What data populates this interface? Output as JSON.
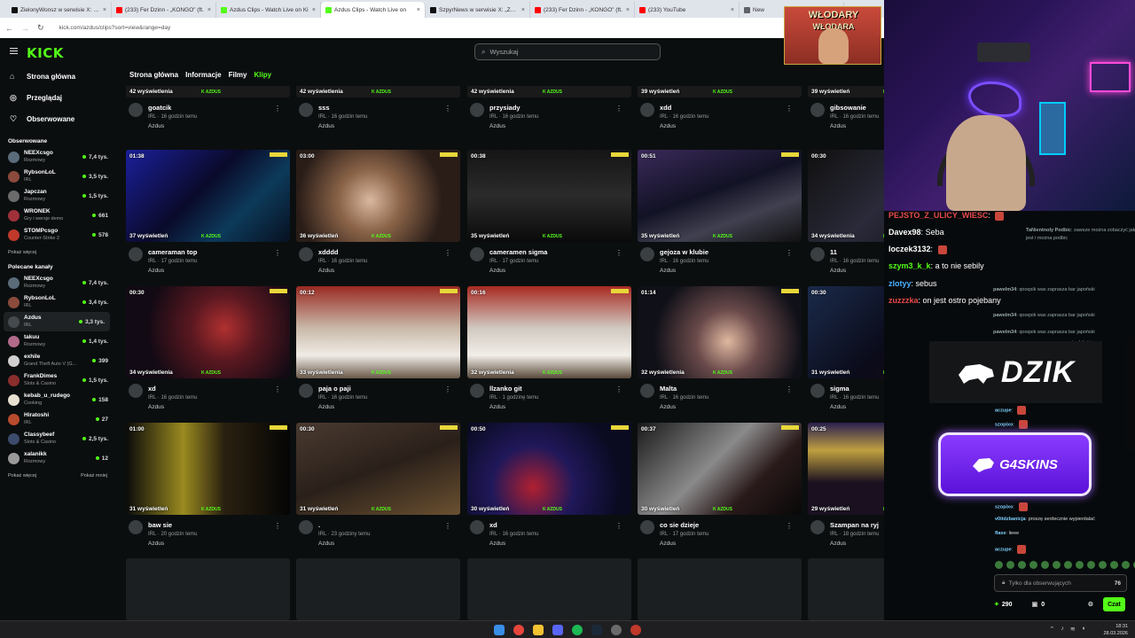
{
  "browser": {
    "tabs": [
      {
        "title": "ZielonyWonsz w serwisie X: „Je",
        "color": "#111111",
        "active": false
      },
      {
        "title": "(233) Fer Dzinn - „KONGO” (ft.",
        "color": "#ff0000",
        "active": false
      },
      {
        "title": "Azdus Clips - Watch Live on Ki",
        "color": "#53fc18",
        "active": false
      },
      {
        "title": "Azdus Clips - Watch Live on",
        "color": "#53fc18",
        "active": true
      },
      {
        "title": "SzpyrNews w serwisie X: „Zaup",
        "color": "#111111",
        "active": false
      },
      {
        "title": "(233) Fer Dzinn - „KONGO” (ft.",
        "color": "#ff0000",
        "active": false
      },
      {
        "title": "(233) YouTube",
        "color": "#ff0000",
        "active": false
      },
      {
        "title": "New",
        "color": "#5f6368",
        "active": false
      }
    ],
    "url": "kick.com/azdus/clips?sort=view&range=day"
  },
  "header": {
    "logo": "KICK",
    "search_placeholder": "Wyszukaj"
  },
  "sidebar": {
    "nav": [
      {
        "label": "Strona główna",
        "icon": "home-icon"
      },
      {
        "label": "Przeglądaj",
        "icon": "compass-icon"
      },
      {
        "label": "Obserwowane",
        "icon": "heart-icon"
      }
    ],
    "followed_title": "Obserwowane",
    "followed": [
      {
        "name": "NEEXcsgo",
        "category": "Rozmowy",
        "viewers": "7,4 tys.",
        "color": "#5a6b7a"
      },
      {
        "name": "RybsonLoL",
        "category": "IRL",
        "viewers": "3,5 tys.",
        "color": "#8a4b3c"
      },
      {
        "name": "Japczan",
        "category": "Rozmowy",
        "viewers": "1,5 tys.",
        "color": "#6b6b6b"
      },
      {
        "name": "WRONEK",
        "category": "Gry i wersje demo",
        "viewers": "661",
        "color": "#a0303a"
      },
      {
        "name": "STOMPcsgo",
        "category": "Counter-Strike 2",
        "viewers": "578",
        "color": "#c0392b"
      }
    ],
    "show_more": "Pokaż więcej",
    "recommended_title": "Polecane kanały",
    "recommended": [
      {
        "name": "NEEXcsgo",
        "category": "Rozmowy",
        "viewers": "7,4 tys.",
        "color": "#5a6b7a",
        "selected": false
      },
      {
        "name": "RybsonLoL",
        "category": "IRL",
        "viewers": "3,4 tys.",
        "color": "#8a4b3c",
        "selected": false
      },
      {
        "name": "Azdus",
        "category": "IRL",
        "viewers": "3,3 tys.",
        "color": "#444a4e",
        "selected": true
      },
      {
        "name": "takuu",
        "category": "Rozmowy",
        "viewers": "1,4 tys.",
        "color": "#b26a8a",
        "selected": false
      },
      {
        "name": "exhile",
        "category": "Grand Theft Auto V (G...",
        "viewers": "399",
        "color": "#d0d0d0",
        "selected": false
      },
      {
        "name": "FrankDimes",
        "category": "Slots & Casino",
        "viewers": "1,5 tys.",
        "color": "#8a2d2d",
        "selected": false
      },
      {
        "name": "kebab_u_rudego",
        "category": "Cooking",
        "viewers": "158",
        "color": "#e8e0d0",
        "selected": false
      },
      {
        "name": "Hiratoshi",
        "category": "IRL",
        "viewers": "27",
        "color": "#b84a2e",
        "selected": false
      },
      {
        "name": "Classybeef",
        "category": "Slots & Casino",
        "viewers": "2,5 tys.",
        "color": "#3c4b6b",
        "selected": false
      },
      {
        "name": "xalanikk",
        "category": "Rozmowy",
        "viewers": "12",
        "color": "#9a9a9a",
        "selected": false
      }
    ],
    "show_more2": "Pokaż więcej",
    "show_less": "Pokaż mniej"
  },
  "subnav": {
    "items": [
      "Strona główna",
      "Informacje",
      "Filmy",
      "Klipy"
    ],
    "active": "Klipy"
  },
  "clips_row0": [
    {
      "views": "42 wyświetlenia",
      "title": "goatcik",
      "sub": "IRL · 16 godzin temu",
      "channel": "Azdus"
    },
    {
      "views": "42 wyświetlenia",
      "title": "sss",
      "sub": "IRL · 16 godzin temu",
      "channel": "Azdus"
    },
    {
      "views": "42 wyświetlenia",
      "title": "przysiady",
      "sub": "IRL · 16 godzin temu",
      "channel": "Azdus"
    },
    {
      "views": "39 wyświetleń",
      "title": "xdd",
      "sub": "IRL · 16 godzin temu",
      "channel": "Azdus"
    },
    {
      "views": "39 wyświetleń",
      "title": "gibsowanie",
      "sub": "IRL · 16 godzin temu",
      "channel": "Azdus"
    }
  ],
  "clips_row1": [
    {
      "duration": "01:38",
      "views": "37 wyświetleń",
      "title": "cameraman top",
      "sub": "IRL · 17 godzin temu",
      "channel": "Azdus",
      "bg": "linear-gradient(135deg,#1b1f9a,#0a0a2a 45%,#0d3a5a 70%,#071020)"
    },
    {
      "duration": "03:00",
      "views": "36 wyświetleń",
      "title": "xdddd",
      "sub": "IRL · 16 godzin temu",
      "channel": "Azdus",
      "bg": "radial-gradient(circle at 45% 55%,#d8b8a0 0,#8b6448 30%,#2a1d18 70%)"
    },
    {
      "duration": "00:38",
      "views": "35 wyświetleń",
      "title": "cameramen sigma",
      "sub": "IRL · 17 godzin temu",
      "channel": "Azdus",
      "bg": "linear-gradient(180deg,#151515,#2b2b2b 50%,#0a0a0a)"
    },
    {
      "duration": "00:51",
      "views": "35 wyświetleń",
      "title": "gejoza w klubie",
      "sub": "IRL · 16 godzin temu",
      "channel": "Azdus",
      "bg": "linear-gradient(160deg,#3a2a5a,#121225 45%,#404050 70%,#101010)"
    },
    {
      "duration": "00:30",
      "views": "34 wyświetlenia",
      "title": "11",
      "sub": "IRL · 16 godzin temu",
      "channel": "Azdus",
      "bg": "linear-gradient(135deg,#101010,#2a2a3a 50%,#0a0a10)"
    }
  ],
  "clips_row2": [
    {
      "duration": "00:30",
      "views": "34 wyświetlenia",
      "title": "xd",
      "sub": "IRL · 16 godzin temu",
      "channel": "Azdus",
      "bg": "radial-gradient(circle at 60% 45%,#b03030 0,#5a1820 30%,#120a14 70%)"
    },
    {
      "duration": "00:12",
      "views": "33 wyświetlenia",
      "title": "paja o paji",
      "sub": "IRL · 16 godzin temu",
      "channel": "Azdus",
      "bg": "linear-gradient(180deg,#9a2a22 0,#c8b8a8 45%,#f0ece6 75%,#6a5a4a)"
    },
    {
      "duration": "00:16",
      "views": "32 wyświetlenia",
      "title": "llzanko git",
      "sub": "IRL · 1 godzinę temu",
      "channel": "Azdus",
      "bg": "linear-gradient(180deg,#a82a22 0,#d0c8c0 45%,#f2eee8 75%,#5a4a3a)"
    },
    {
      "duration": "01:14",
      "views": "32 wyświetlenia",
      "title": "Malta",
      "sub": "IRL · 16 godzin temu",
      "channel": "Azdus",
      "bg": "radial-gradient(circle at 55% 60%,#e0b8a0 0,#6a4a4a 30%,#101018 70%)"
    },
    {
      "duration": "00:30",
      "views": "31 wyświetleń",
      "title": "sigma",
      "sub": "IRL · 16 godzin temu",
      "channel": "Azdus",
      "bg": "linear-gradient(135deg,#1a2a4a,#0a0a18 55%,#2a1020)"
    }
  ],
  "clips_row3": [
    {
      "duration": "01:00",
      "views": "31 wyświetleń",
      "title": "baw sie",
      "sub": "IRL · 20 godzin temu",
      "channel": "Azdus",
      "bg": "linear-gradient(90deg,#0a0a0a,#9a8a20 35%,#2a2010 60%,#050505)"
    },
    {
      "duration": "00:30",
      "views": "31 wyświetleń",
      "title": ".",
      "sub": "IRL · 23 godziny temu",
      "channel": "Azdus",
      "bg": "linear-gradient(160deg,#4a3a30,#2a201a 50%,#6a5030)"
    },
    {
      "duration": "00:50",
      "views": "30 wyświetleń",
      "title": "xd",
      "sub": "IRL · 16 godzin temu",
      "channel": "Azdus",
      "bg": "radial-gradient(circle at 40% 70%,#b02030 0,#20185a 35%,#0a0a20 75%)"
    },
    {
      "duration": "00:37",
      "views": "30 wyświetleń",
      "title": "co sie dzieje",
      "sub": "IRL · 17 godzin temu",
      "channel": "Azdus",
      "bg": "linear-gradient(135deg,#1a1a1a,#8a8a8a 45%,#2a1a1a 70%,#080808)"
    },
    {
      "duration": "00:25",
      "views": "29 wyświetleń",
      "title": "Szampan na ryj",
      "sub": "IRL · 18 godzin temu",
      "channel": "Azdus",
      "bg": "linear-gradient(180deg,#2a2050,#c0a040 30%,#1a1020 65%)"
    }
  ],
  "watermark": "K AZDUS",
  "overlay": {
    "poster_line1": "WŁODARY",
    "poster_line2": "WŁODARA",
    "chat_big": [
      {
        "user": "PEJSTO_Z_ULICY_WIESC",
        "msg": "",
        "color": "#e84a4a"
      },
      {
        "user": "Davex98",
        "msg": "Seba",
        "color": "#ffffff"
      },
      {
        "user": "loczek3132",
        "msg": "",
        "color": "#ffffff"
      },
      {
        "user": "szym3_k_k",
        "msg": "a to nie sebily",
        "color": "#53fc18"
      },
      {
        "user": "zlotyy",
        "msg": "sebus",
        "color": "#4ab0ff"
      },
      {
        "user": "zuzzzka",
        "msg": "on jest ostro pojebany",
        "color": "#e84a4a"
      }
    ],
    "chat_small": [
      {
        "user": "TaNientnoly Podbic",
        "msg": "zawsze można zobaczyć jak gdzie ona jest i można podbic",
        "color": "#9aa"
      },
      {
        "user": "pawelm34",
        "msg": "qooqsik was zaprasza bar japoński",
        "color": "#9aa"
      },
      {
        "user": "pawelm34",
        "msg": "qooqsik was zaprasza bar japoński",
        "color": "#9aa"
      },
      {
        "user": "pawelm34",
        "msg": "qooqsik was zaprasza bar japoński",
        "color": "#9aa"
      },
      {
        "user": "",
        "msg": "wypierdalać i",
        "color": "#9aa"
      }
    ],
    "dzik": "DZIK",
    "g4skins": "G4SKINS",
    "chat_lower": [
      {
        "user": "aczupe",
        "msg": ""
      },
      {
        "user": "szopixo",
        "msg": ""
      },
      {
        "user": "szopixo",
        "msg": ""
      },
      {
        "user": "v0itdzbanicja",
        "msg": "proszę serdecznie wypierdalać"
      },
      {
        "user": "flaxe",
        "msg": "lieee"
      },
      {
        "user": "aczupe",
        "msg": ""
      }
    ],
    "chat_input_placeholder": "Tylko dla obserwujących",
    "chat_input_count": "76",
    "points": "290",
    "other": "0",
    "send": "Czat"
  },
  "taskbar": {
    "time": "18:31",
    "date": "28.03.2026"
  }
}
